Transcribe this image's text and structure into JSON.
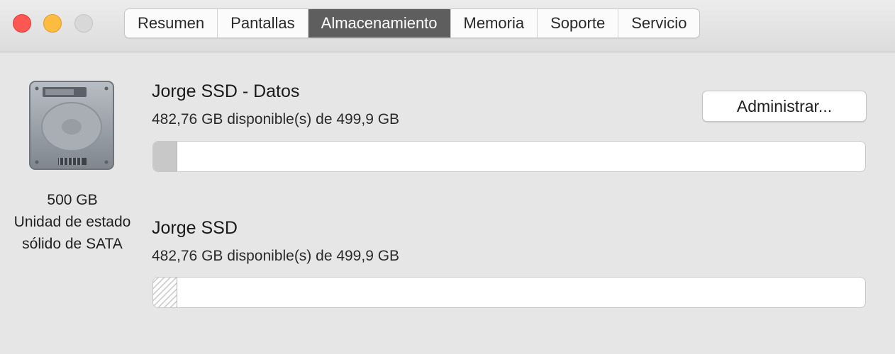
{
  "window": {
    "traffic_lights": [
      "close",
      "minimize",
      "zoom"
    ]
  },
  "tabs": [
    {
      "label": "Resumen",
      "active": false
    },
    {
      "label": "Pantallas",
      "active": false
    },
    {
      "label": "Almacenamiento",
      "active": true
    },
    {
      "label": "Memoria",
      "active": false
    },
    {
      "label": "Soporte",
      "active": false
    },
    {
      "label": "Servicio",
      "active": false
    }
  ],
  "disk": {
    "icon": "hard-drive-icon",
    "capacity": "500 GB",
    "type_line1": "Unidad de estado",
    "type_line2": "sólido de SATA"
  },
  "volumes": [
    {
      "name": "Jorge SSD - Datos",
      "availability": "482,76 GB disponible(s) de 499,9 GB",
      "used_fraction": 0.034
    },
    {
      "name": "Jorge SSD",
      "availability": "482,76 GB disponible(s) de 499,9 GB",
      "used_fraction": 0.034
    }
  ],
  "manage_button": {
    "label": "Administrar..."
  },
  "colors": {
    "close": "#fc5753",
    "minimize": "#fdbc40",
    "zoom": "#d8d8d8",
    "active_tab": "#5e5e5e"
  }
}
